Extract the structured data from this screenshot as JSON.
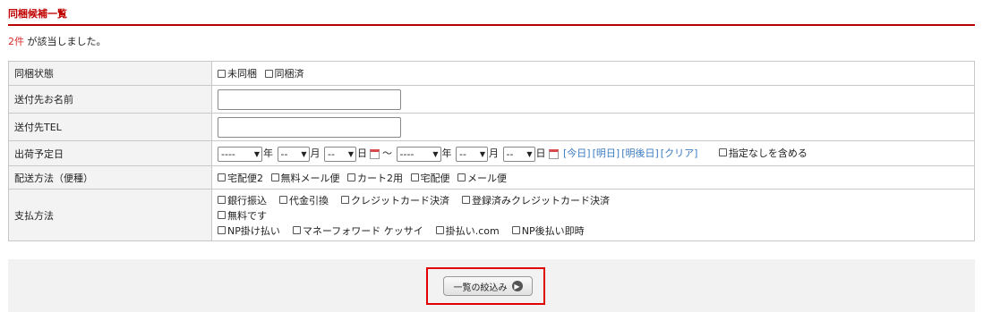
{
  "section": {
    "title": "同梱候補一覧",
    "result_count": "2件",
    "result_suffix": " が該当しました。"
  },
  "criteria": {
    "bundle_status": {
      "label": "同梱状態",
      "options": [
        "未同梱",
        "同梱済"
      ]
    },
    "recipient_name": {
      "label": "送付先お名前",
      "value": ""
    },
    "recipient_tel": {
      "label": "送付先TEL",
      "value": ""
    },
    "ship_date": {
      "label": "出荷予定日",
      "year_placeholder": "----",
      "md_placeholder": "--",
      "unit_year": "年",
      "unit_month": "月",
      "unit_day": "日",
      "tilde": "～",
      "links": [
        "[今日]",
        "[明日]",
        "[明後日]",
        "[クリア]"
      ],
      "include_unset": "指定なしを含める"
    },
    "delivery_method": {
      "label": "配送方法（便種）",
      "options": [
        "宅配便2",
        "無料メール便",
        "カート2用",
        "宅配便",
        "メール便"
      ]
    },
    "payment_method": {
      "label": "支払方法",
      "row1": [
        "銀行振込",
        "代金引換",
        "クレジットカード決済",
        "登録済みクレジットカード決済"
      ],
      "row2": [
        "無料です"
      ],
      "row3": [
        "NP掛け払い",
        "マネーフォワード ケッサイ",
        "掛払い.com",
        "NP後払い即時"
      ]
    }
  },
  "filter_button": {
    "label": "一覧の絞込み"
  },
  "colors": {
    "title": "#c00000",
    "result_count": "#d62b2b",
    "link": "#3a7bbf",
    "highlight": "#e00000"
  },
  "icons": {
    "calendar": "calendar-icon",
    "chevron": "chevron-down-icon",
    "arrow": "arrow-right-circle-icon"
  }
}
